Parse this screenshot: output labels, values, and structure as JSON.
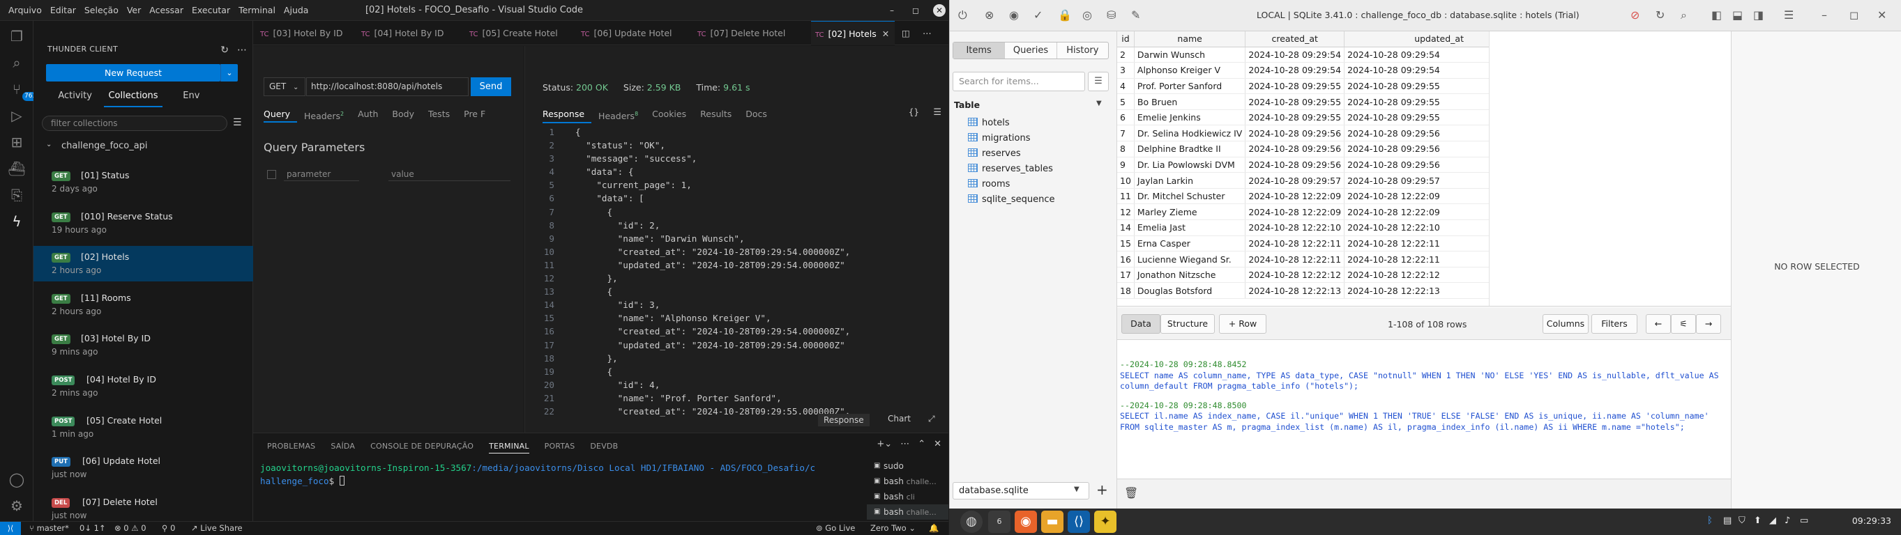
{
  "vscode": {
    "menu": [
      "Arquivo",
      "Editar",
      "Seleção",
      "Ver",
      "Acessar",
      "Executar",
      "Terminal",
      "Ajuda"
    ],
    "title": "[02] Hotels - FOCO_Desafio - Visual Studio Code",
    "activity_badge": "763",
    "sidebar": {
      "header": "THUNDER CLIENT",
      "new_request": "New Request",
      "tabs": [
        "Activity",
        "Collections",
        "Env"
      ],
      "filter_placeholder": "filter collections",
      "collection_name": "challenge_foco_api",
      "requests": [
        {
          "method": "GET",
          "name": "[01] Status",
          "time": "2 days ago"
        },
        {
          "method": "GET",
          "name": "[010] Reserve Status",
          "time": "19 hours ago"
        },
        {
          "method": "GET",
          "name": "[02] Hotels",
          "time": "2 hours ago"
        },
        {
          "method": "GET",
          "name": "[11] Rooms",
          "time": "2 hours ago"
        },
        {
          "method": "GET",
          "name": "[03] Hotel By ID",
          "time": "9 mins ago"
        },
        {
          "method": "POST",
          "name": "[04] Hotel By ID",
          "time": "2 mins ago"
        },
        {
          "method": "POST",
          "name": "[05] Create Hotel",
          "time": "1 min ago"
        },
        {
          "method": "PUT",
          "name": "[06] Update Hotel",
          "time": "just now"
        },
        {
          "method": "DEL",
          "name": "[07] Delete Hotel",
          "time": "just now"
        }
      ]
    },
    "editor_tabs": [
      "[03] Hotel By ID",
      "[04] Hotel By ID",
      "[05] Create Hotel",
      "[06] Update Hotel",
      "[07] Delete Hotel",
      "[02] Hotels"
    ],
    "request": {
      "method": "GET",
      "url": "http://localhost:8080/api/hotels",
      "send": "Send",
      "tabs": [
        {
          "label": "Query",
          "count": ""
        },
        {
          "label": "Headers",
          "count": "2"
        },
        {
          "label": "Auth",
          "count": ""
        },
        {
          "label": "Body",
          "count": ""
        },
        {
          "label": "Tests",
          "count": ""
        },
        {
          "label": "Pre F",
          "count": ""
        }
      ],
      "query_title": "Query Parameters",
      "param_placeholder": "parameter",
      "value_placeholder": "value"
    },
    "response": {
      "status_label": "Status:",
      "status": "200 OK",
      "size_label": "Size:",
      "size": "2.59 KB",
      "time_label": "Time:",
      "time": "9.61 s",
      "tabs": [
        {
          "label": "Response",
          "count": ""
        },
        {
          "label": "Headers",
          "count": "8"
        },
        {
          "label": "Cookies",
          "count": ""
        },
        {
          "label": "Results",
          "count": ""
        },
        {
          "label": "Docs",
          "count": ""
        }
      ],
      "braces": "{}",
      "footer": [
        "Response",
        "Chart"
      ],
      "code_lines": [
        "{",
        "  \"status\": \"OK\",",
        "  \"message\": \"success\",",
        "  \"data\": {",
        "    \"current_page\": 1,",
        "    \"data\": [",
        "      {",
        "        \"id\": 2,",
        "        \"name\": \"Darwin Wunsch\",",
        "        \"created_at\": \"2024-10-28T09:29:54.000000Z\",",
        "        \"updated_at\": \"2024-10-28T09:29:54.000000Z\"",
        "      },",
        "      {",
        "        \"id\": 3,",
        "        \"name\": \"Alphonso Kreiger V\",",
        "        \"created_at\": \"2024-10-28T09:29:54.000000Z\",",
        "        \"updated_at\": \"2024-10-28T09:29:54.000000Z\"",
        "      },",
        "      {",
        "        \"id\": 4,",
        "        \"name\": \"Prof. Porter Sanford\",",
        "        \"created_at\": \"2024-10-28T09:29:55.000000Z\","
      ]
    },
    "panel": {
      "tabs": [
        "PROBLEMAS",
        "SAÍDA",
        "CONSOLE DE DEPURAÇÃO",
        "TERMINAL",
        "PORTAS",
        "DEVDB"
      ],
      "terminal_user": "joaovitorns@joaovitorns-Inspiron-15-3567",
      "terminal_path": ":/media/joaovitorns/Disco Local HD1/IFBAIANO - ADS/FOCO_Desafio/c",
      "terminal_path2": "hallenge_foco",
      "terminal_prompt": "$ ",
      "terminals": [
        {
          "name": "sudo",
          "sub": ""
        },
        {
          "name": "bash",
          "sub": "challe..."
        },
        {
          "name": "bash",
          "sub": "cli"
        },
        {
          "name": "bash",
          "sub": "challe..."
        }
      ]
    },
    "statusbar": {
      "branch": "master*",
      "sync": "0↓ 1↑",
      "problems": "⊗ 0 ⚠ 0",
      "ports": "0",
      "live_share": "Live Share",
      "go_live": "Go Live",
      "zoom": "Zero Two"
    }
  },
  "db": {
    "title": "LOCAL | SQLite 3.41.0 : challenge_foco_db : database.sqlite : hotels (Trial)",
    "seg": [
      "Items",
      "Queries",
      "History"
    ],
    "search_placeholder": "Search for items...",
    "table_header": "Table",
    "tables": [
      "hotels",
      "migrations",
      "reserves",
      "reserves_tables",
      "rooms",
      "sqlite_sequence"
    ],
    "database": "database.sqlite",
    "columns": [
      "id",
      "name",
      "created_at",
      "updated_at"
    ],
    "rows": [
      [
        "2",
        "Darwin Wunsch",
        "2024-10-28 09:29:54",
        "2024-10-28 09:29:54"
      ],
      [
        "3",
        "Alphonso Kreiger V",
        "2024-10-28 09:29:54",
        "2024-10-28 09:29:54"
      ],
      [
        "4",
        "Prof. Porter Sanford",
        "2024-10-28 09:29:55",
        "2024-10-28 09:29:55"
      ],
      [
        "5",
        "Bo Bruen",
        "2024-10-28 09:29:55",
        "2024-10-28 09:29:55"
      ],
      [
        "6",
        "Emelie Jenkins",
        "2024-10-28 09:29:55",
        "2024-10-28 09:29:55"
      ],
      [
        "7",
        "Dr. Selina Hodkiewicz IV",
        "2024-10-28 09:29:56",
        "2024-10-28 09:29:56"
      ],
      [
        "8",
        "Delphine Bradtke II",
        "2024-10-28 09:29:56",
        "2024-10-28 09:29:56"
      ],
      [
        "9",
        "Dr. Lia Powlowski DVM",
        "2024-10-28 09:29:56",
        "2024-10-28 09:29:56"
      ],
      [
        "10",
        "Jaylan Larkin",
        "2024-10-28 09:29:57",
        "2024-10-28 09:29:57"
      ],
      [
        "11",
        "Dr. Mitchel Schuster",
        "2024-10-28 12:22:09",
        "2024-10-28 12:22:09"
      ],
      [
        "12",
        "Marley Zieme",
        "2024-10-28 12:22:09",
        "2024-10-28 12:22:09"
      ],
      [
        "14",
        "Emelia Jast",
        "2024-10-28 12:22:10",
        "2024-10-28 12:22:10"
      ],
      [
        "15",
        "Erna Casper",
        "2024-10-28 12:22:11",
        "2024-10-28 12:22:11"
      ],
      [
        "16",
        "Lucienne Wiegand Sr.",
        "2024-10-28 12:22:11",
        "2024-10-28 12:22:11"
      ],
      [
        "17",
        "Jonathon Nitzsche",
        "2024-10-28 12:22:12",
        "2024-10-28 12:22:12"
      ],
      [
        "18",
        "Douglas Botsford",
        "2024-10-28 12:22:13",
        "2024-10-28 12:22:13"
      ]
    ],
    "gridbar": {
      "data": "Data",
      "structure": "Structure",
      "add_row": "+ Row",
      "rowcount": "1-108 of 108 rows",
      "columns": "Columns",
      "filters": "Filters"
    },
    "sql_log": [
      {
        "comment": "--2024-10-28 09:28:48.8452",
        "sql": "SELECT name AS column_name, TYPE AS data_type, CASE \"notnull\" WHEN 1 THEN 'NO' ELSE 'YES' END AS is_nullable, dflt_value AS column_default FROM pragma_table_info (\"hotels\");"
      },
      {
        "comment": "--2024-10-28 09:28:48.8500",
        "sql": "SELECT il.name AS index_name, CASE il.\"unique\" WHEN 1 THEN 'TRUE' ELSE 'FALSE' END AS is_unique, ii.name AS 'column_name' FROM sqlite_master AS m, pragma_index_list (m.name) AS il, pragma_index_info (il.name) AS ii WHERE m.name =\"hotels\";"
      }
    ],
    "no_row": "NO ROW SELECTED"
  },
  "taskbar": {
    "workspace": "6",
    "clock": "09:29:33"
  },
  "colors": {
    "accent": "#0078d4",
    "get": "#3a7d44",
    "post": "#3b8a5a",
    "put": "#1f6fb2",
    "del": "#c74b4b",
    "status_ok": "#73c991"
  }
}
